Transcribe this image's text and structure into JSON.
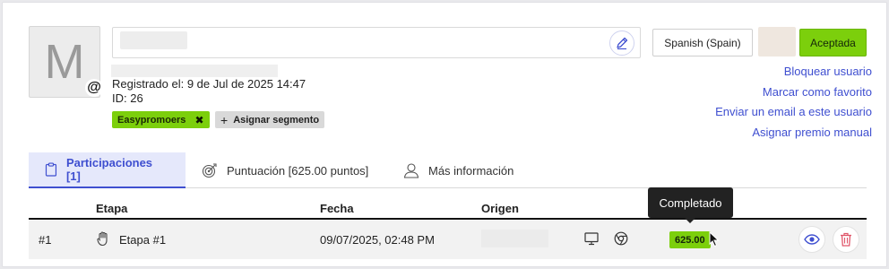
{
  "profile": {
    "avatar_letter": "M",
    "at_symbol": "@",
    "registered": "Registrado el: 9 de Jul de 2025 14:47",
    "id": "ID: 26",
    "segment_tag": "Easypromoers",
    "segment_remove": "✖",
    "assign_segment": "Asignar segmento",
    "assign_plus": "+"
  },
  "header_actions": {
    "language": "Spanish (Spain)",
    "status": "Aceptada"
  },
  "links": [
    "Bloquear usuario",
    "Marcar como favorito",
    "Enviar un email a este usuario",
    "Asignar premio manual"
  ],
  "tabs": [
    {
      "label": "Participaciones [1]",
      "icon": "clipboard-icon"
    },
    {
      "label": "Puntuación [625.00 puntos]",
      "icon": "target-icon"
    },
    {
      "label": "Más información",
      "icon": "user-icon"
    }
  ],
  "table": {
    "headers": [
      "Etapa",
      "Fecha",
      "Origen"
    ],
    "row": {
      "number": "#1",
      "stage": "Etapa #1",
      "date": "09/07/2025, 02:48 PM",
      "score": "625.00"
    },
    "tooltip": "Completado"
  },
  "colors": {
    "accent": "#3f4fd0",
    "green": "#7ccf0c",
    "danger": "#e0566a"
  }
}
